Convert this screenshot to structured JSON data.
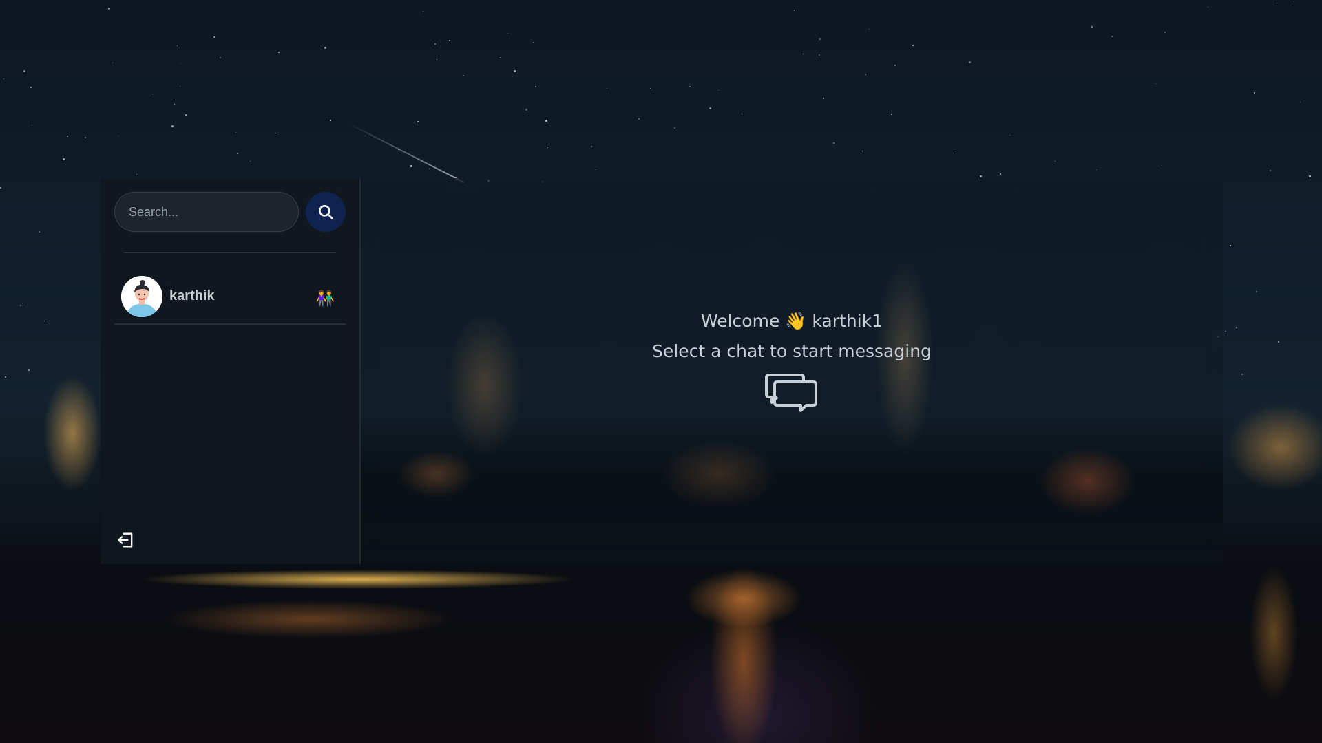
{
  "search": {
    "placeholder": "Search...",
    "button_icon": "search-icon"
  },
  "conversations": [
    {
      "name": "karthik",
      "avatar": "avatar-icon",
      "emoji": "👫"
    }
  ],
  "welcome": {
    "greeting": "Welcome",
    "wave": "👋",
    "username": "karthik1",
    "subtitle": "Select a chat to start messaging",
    "icon": "chat-bubbles-icon"
  },
  "logout": {
    "icon": "logout-icon"
  },
  "colors": {
    "search_button": "#0f2350",
    "sidebar_bg": "#11171e",
    "text": "#c9cfd7"
  }
}
